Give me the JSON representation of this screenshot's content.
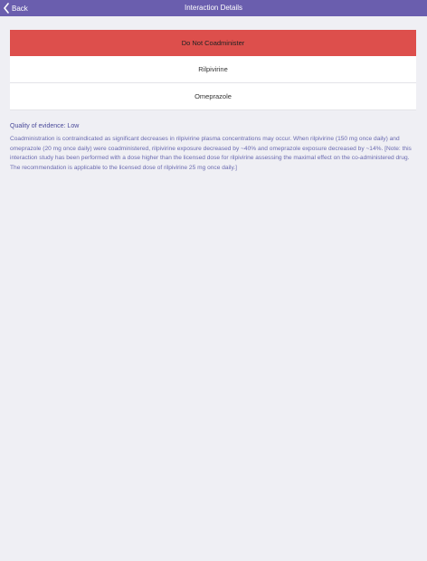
{
  "navbar": {
    "back_label": "Back",
    "title": "Interaction Details",
    "back_icon": "chevron-left-icon",
    "color": "#6a5eae"
  },
  "interaction": {
    "status": "Do Not Coadminister",
    "status_color": "#dd4f4c",
    "drug_a": "Rilpivirine",
    "drug_b": "Omeprazole"
  },
  "details": {
    "quality": "Quality of evidence: Low",
    "description": "Coadministration is contraindicated as significant decreases in rilpivirine plasma concentrations may occur. When rilpivirine (150 mg once daily) and omeprazole (20 mg once daily) were coadministered, rilpivirine exposure decreased by ~40% and omeprazole exposure decreased by ~14%. [Note: this interaction study has been performed with a dose higher than the licensed dose for rilpivirine assessing the maximal effect on the co-administered drug. The recommendation is applicable to the licensed dose of rilpivirine 25 mg once daily.]"
  }
}
